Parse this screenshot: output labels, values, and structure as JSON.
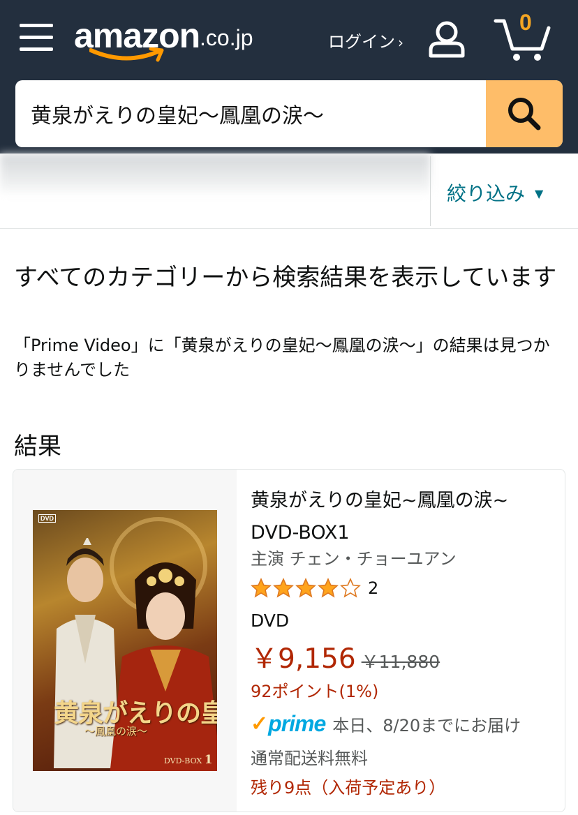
{
  "header": {
    "logo_text": "amazon",
    "logo_tld": ".co.jp",
    "signin_label": "ログイン",
    "signin_chevron": "›",
    "cart_count": "0",
    "colors": {
      "background": "#232f3e",
      "search_button": "#febd69",
      "cart_count": "#f5a623"
    }
  },
  "search": {
    "value": "黄泉がえりの皇妃〜鳳凰の涙〜",
    "icon": "search-icon"
  },
  "filter": {
    "label": "絞り込み",
    "chevron": "⌄",
    "color": "#007185"
  },
  "messages": {
    "main": "すべてのカテゴリーから検索結果を表示しています",
    "sub": "「Prime Video」に「黄泉がえりの皇妃〜鳳凰の涙〜」の結果は見つかりませんでした"
  },
  "results": {
    "heading": "結果",
    "items": [
      {
        "title": "黄泉がえりの皇妃~鳳凰の涙~ DVD-BOX1",
        "author": "主演 チェン・チョーユアン",
        "rating": 4,
        "rating_max": 5,
        "rating_count": "2",
        "format": "DVD",
        "price": "￥9,156",
        "list_price": "￥11,880",
        "points": "92ポイント(1%)",
        "prime_label": "prime",
        "prime_check": "✓",
        "delivery": "本日、8/20までにお届け",
        "shipping": "通常配送料無料",
        "stock": "残り9点（入荷予定あり）",
        "cover": {
          "badge": "DVD",
          "title": "黄泉がえりの皇妃",
          "subtitle": "〜鳳凰の涙〜",
          "box_label": "DVD-BOX",
          "box_number": "1"
        }
      }
    ]
  }
}
